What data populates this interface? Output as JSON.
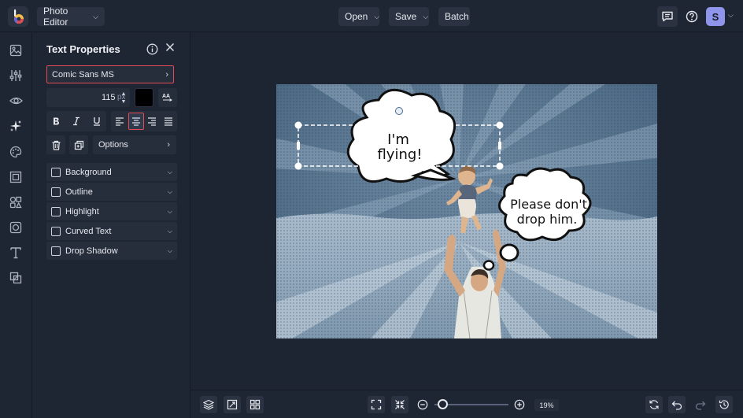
{
  "topbar": {
    "app_menu_label": "Photo Editor",
    "open_label": "Open",
    "save_label": "Save",
    "batch_label": "Batch",
    "avatar_initial": "S"
  },
  "rail": {
    "items": [
      "image-icon",
      "adjust-icon",
      "eye-icon",
      "effects-icon",
      "palette-icon",
      "frames-icon",
      "graphics-icon",
      "overlays-icon",
      "text-icon",
      "textures-icon"
    ]
  },
  "panel": {
    "title": "Text Properties",
    "font_name": "Comic Sans MS",
    "font_size": "115",
    "size_unit": "px",
    "text_color": "#000000",
    "options_label": "Options",
    "sections": [
      {
        "label": "Background"
      },
      {
        "label": "Outline"
      },
      {
        "label": "Highlight"
      },
      {
        "label": "Curved Text"
      },
      {
        "label": "Drop Shadow"
      }
    ]
  },
  "canvas": {
    "bubble1_line1": "I'm",
    "bubble1_line2": "flying!",
    "bubble2_line1": "Please don't",
    "bubble2_line2": "drop him."
  },
  "bottombar": {
    "zoom_level": "19%",
    "zoom_value": 0.19
  },
  "colors": {
    "accent_red": "#e24a55",
    "avatar_bg": "#8e95ea",
    "bg": "#1e2532"
  }
}
